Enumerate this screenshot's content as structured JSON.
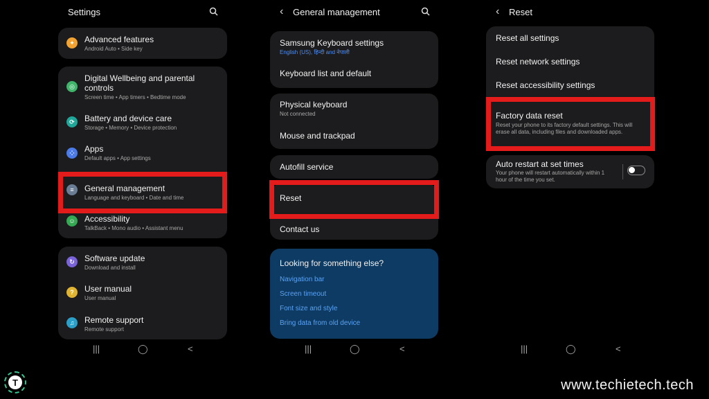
{
  "settings": {
    "title": "Settings",
    "groups": [
      {
        "items": [
          {
            "title": "Advanced features",
            "sub": "Android Auto  •  Side key",
            "icon": "advanced-features-icon",
            "color": "#f2a230"
          }
        ]
      },
      {
        "items": [
          {
            "title": "Digital Wellbeing and parental",
            "title2": "controls",
            "sub": "Screen time  •  App timers  •  Bedtime mode",
            "icon": "wellbeing-icon",
            "color": "#3fb46a"
          },
          {
            "title": "Battery and device care",
            "sub": "Storage  •  Memory  •  Device protection",
            "icon": "battery-care-icon",
            "color": "#1fa79a"
          },
          {
            "title": "Apps",
            "sub": "Default apps  •  App settings",
            "icon": "apps-icon",
            "color": "#4b7be8"
          },
          {
            "title": "General management",
            "sub": "Language and keyboard  •  Date and time",
            "icon": "general-management-icon",
            "color": "#6a7d95"
          },
          {
            "title": "Accessibility",
            "sub": "TalkBack  •  Mono audio  •  Assistant menu",
            "icon": "accessibility-icon",
            "color": "#35a853"
          }
        ]
      },
      {
        "items": [
          {
            "title": "Software update",
            "sub": "Download and install",
            "icon": "software-update-icon",
            "color": "#7a63d9"
          },
          {
            "title": "User manual",
            "sub": "User manual",
            "icon": "user-manual-icon",
            "color": "#e0b431"
          },
          {
            "title": "Remote support",
            "sub": "Remote support",
            "icon": "remote-support-icon",
            "color": "#2aa0c8"
          }
        ]
      }
    ]
  },
  "general": {
    "title": "General management",
    "items": [
      {
        "title": "Samsung Keyboard settings",
        "sub": "English (US), हिन्दी and नेपाली"
      },
      {
        "title": "Keyboard list and default"
      },
      {
        "title": "Physical keyboard",
        "sub": "Not connected"
      },
      {
        "title": "Mouse and trackpad"
      },
      {
        "title": "Autofill service"
      },
      {
        "title": "Reset"
      },
      {
        "title": "Contact us"
      }
    ],
    "looking": {
      "heading": "Looking for something else?",
      "links": [
        "Navigation bar",
        "Screen timeout",
        "Font size and style",
        "Bring data from old device"
      ]
    }
  },
  "reset": {
    "title": "Reset",
    "items": [
      {
        "title": "Reset all settings"
      },
      {
        "title": "Reset network settings"
      },
      {
        "title": "Reset accessibility settings"
      },
      {
        "title": "Factory data reset",
        "sub": "Reset your phone to its factory default settings. This will",
        "sub2": "erase all data, including files and downloaded apps."
      },
      {
        "title": "Auto restart at set times",
        "sub": "Your phone will restart automatically within 1",
        "sub2": "hour of the time you set."
      }
    ]
  },
  "nav": {
    "recents": "|||",
    "home": "◯",
    "back": "<"
  },
  "watermark": {
    "site": "www.techietech.tech",
    "logo_letter": "T"
  },
  "colors": {
    "highlight": "#e31b1b",
    "card": "#1c1c1e",
    "link": "#5aa2f5"
  }
}
